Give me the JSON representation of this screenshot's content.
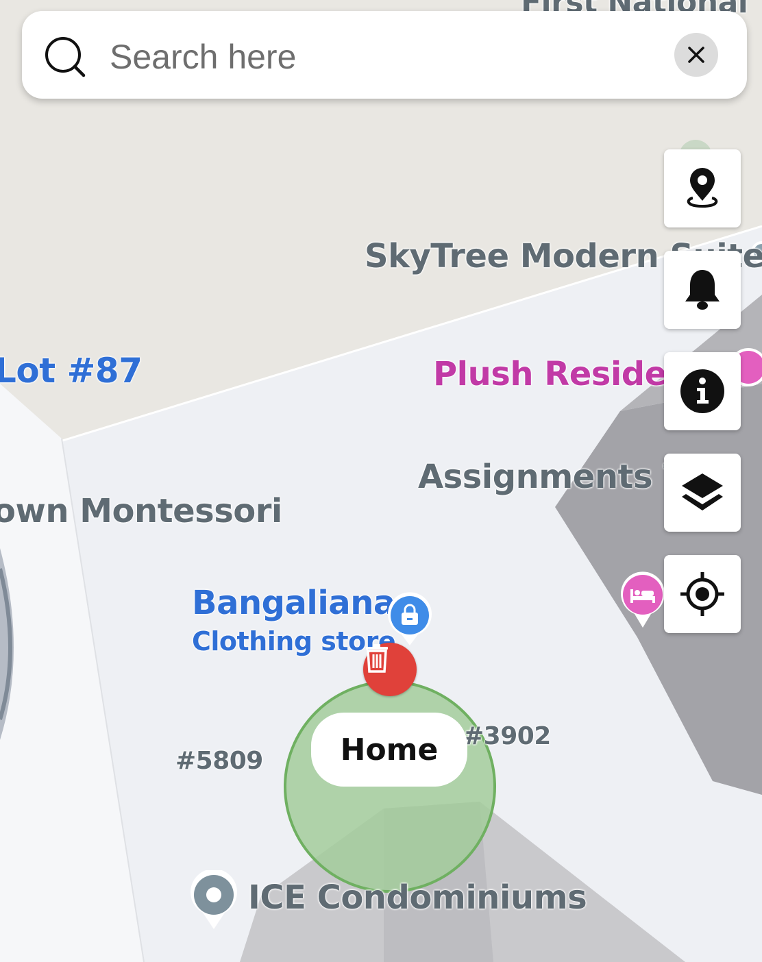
{
  "search": {
    "placeholder": "Search here",
    "value": "",
    "clear_icon": "close-icon"
  },
  "controls": [
    {
      "name": "place-pin",
      "icon": "map-pin-icon"
    },
    {
      "name": "notifications",
      "icon": "bell-icon"
    },
    {
      "name": "info",
      "icon": "info-icon"
    },
    {
      "name": "layers",
      "icon": "layers-icon"
    },
    {
      "name": "my-location",
      "icon": "crosshair-icon"
    }
  ],
  "map": {
    "labels": {
      "first_national": "First National",
      "skytree": "SkyTree Modern Suites",
      "lot87": "Lot #87",
      "plush": "Plush Residences",
      "assignments": "Assignments To",
      "montessori": "own Montessori",
      "bangaliana": "Bangaliana",
      "clothing_store": "Clothing store",
      "num_3902": "#3902",
      "num_5809": "#5809",
      "ice": "ICE Condominiums"
    },
    "home": {
      "label": "Home",
      "delete_icon": "trash-icon",
      "circle_color": "#a3cd9b"
    },
    "colors": {
      "land": "#e8e6e1",
      "urban": "#edeef2",
      "building": "#9a9a9f",
      "clothing_pin": "#3f8ce8",
      "hotel_pin": "#e35fbf",
      "home_delete": "#e0413a"
    }
  }
}
